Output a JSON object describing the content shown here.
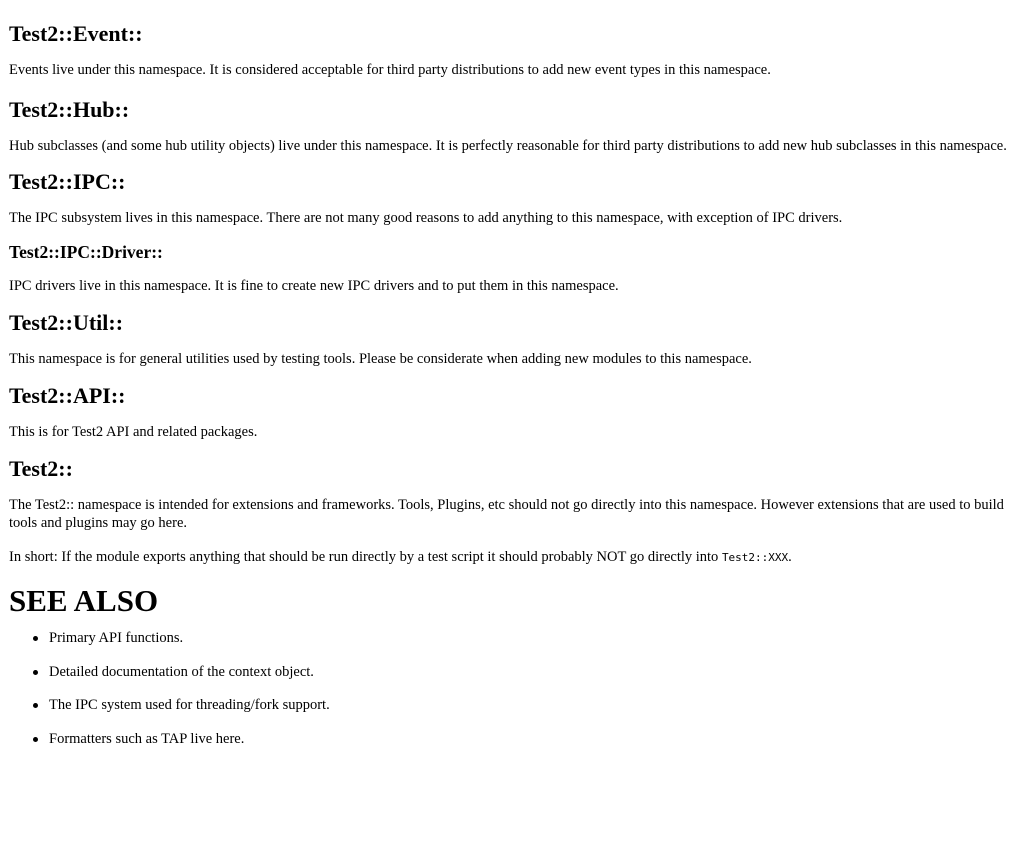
{
  "sections": [
    {
      "heading": "Test2::Event::",
      "paragraphs": [
        "Events live under this namespace. It is considered acceptable for third party distributions to add new event types in this namespace."
      ]
    },
    {
      "heading": "Test2::Hub::",
      "paragraphs": [
        "Hub subclasses (and some hub utility objects) live under this namespace. It is perfectly reasonable for third party distributions to add new hub subclasses in this namespace."
      ]
    },
    {
      "heading": "Test2::IPC::",
      "paragraphs": [
        "The IPC subsystem lives in this namespace. There are not many good reasons to add anything to this namespace, with exception of IPC drivers."
      ]
    },
    {
      "heading": "Test2::IPC::Driver::",
      "paragraphs": [
        "IPC drivers live in this namespace. It is fine to create new IPC drivers and to put them in this namespace."
      ]
    },
    {
      "heading": "Test2::Util::",
      "paragraphs": [
        "This namespace is for general utilities used by testing tools. Please be considerate when adding new modules to this namespace."
      ]
    },
    {
      "heading": "Test2::API::",
      "paragraphs": [
        "This is for Test2 API and related packages."
      ]
    },
    {
      "heading": "Test2::",
      "paragraphs": [
        "The Test2:: namespace is intended for extensions and frameworks. Tools, Plugins, etc should not go directly into this namespace. However extensions that are used to build tools and plugins may go here."
      ],
      "short_prefix": "In short: If the module exports anything that should be run directly by a test script it should probably NOT go directly into ",
      "short_code": "Test2::XXX",
      "short_suffix": "."
    }
  ],
  "see_also": {
    "heading": "SEE ALSO",
    "items": [
      "Primary API functions.",
      "Detailed documentation of the context object.",
      "The IPC system used for threading/fork support.",
      "Formatters such as TAP live here."
    ]
  }
}
